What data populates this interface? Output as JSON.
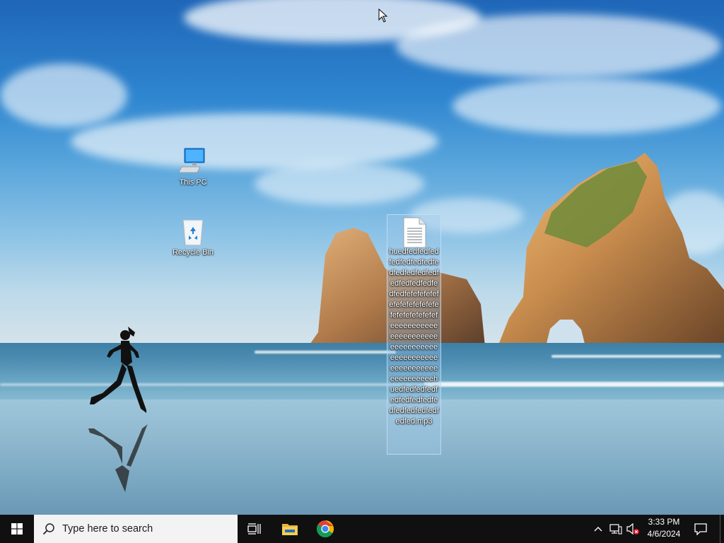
{
  "desktop": {
    "icons": [
      {
        "label": "This PC",
        "icon": "computer-icon"
      },
      {
        "label": "Recycle Bin",
        "icon": "recycle-bin-icon"
      }
    ],
    "selected_file": {
      "label": "huedfedfedfedfedfedfedfedfedfedfedfedfedfedfedfedfedfedfedfefefefefefefefefefefefefefefefefefefefefeeeeeeeeeeeeeeeeeeeeeeeeeeeeeeeeeeeeeeeeeeeeeeeeeeeeeeeeeeeeeeeeehuedfedfedfedfedfedfedfedfedfedfedfedfedfedfed.mp3",
      "icon": "document-icon"
    }
  },
  "taskbar": {
    "start_icon": "windows-logo-icon",
    "search_placeholder": "Type here to search",
    "apps": [
      {
        "name": "Task View",
        "icon": "task-view-icon"
      },
      {
        "name": "File Explorer",
        "icon": "file-explorer-icon"
      },
      {
        "name": "Google Chrome",
        "icon": "chrome-icon"
      }
    ],
    "tray_icons": [
      "chevron-up-icon",
      "network-icon",
      "volume-muted-icon"
    ],
    "time": "3:33 PM",
    "date": "4/6/2024",
    "notification_icon": "action-center-icon"
  },
  "colors": {
    "taskbar_bg": "#101010",
    "search_bg": "#f3f3f3",
    "accent_blue": "#0078d7"
  }
}
